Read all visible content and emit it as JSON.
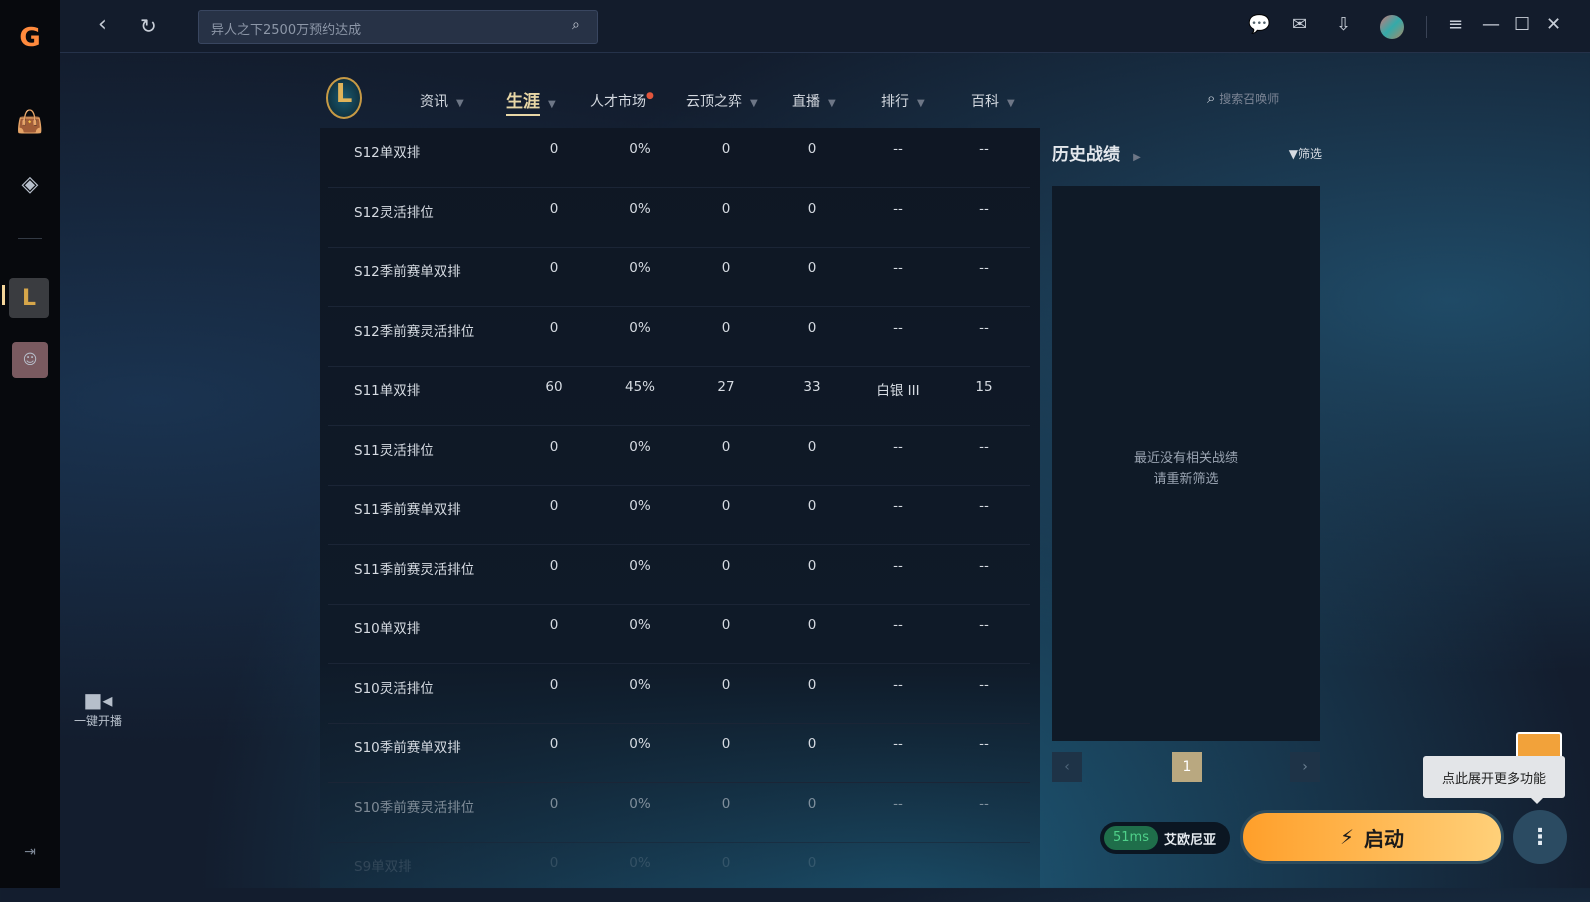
{
  "topbar": {
    "search_placeholder": "异人之下2500万预约达成"
  },
  "nav": {
    "items": [
      {
        "label": "资讯"
      },
      {
        "label": "生涯",
        "active": true
      },
      {
        "label": "人才市场"
      },
      {
        "label": "云顶之弈"
      },
      {
        "label": "直播"
      },
      {
        "label": "排行"
      },
      {
        "label": "百科"
      }
    ],
    "search_placeholder": "搜索召唤师"
  },
  "sidebar": {
    "live_label": "一键开播"
  },
  "table": {
    "rows": [
      [
        "S12单双排",
        "0",
        "0%",
        "0",
        "0",
        "--",
        "--"
      ],
      [
        "S12灵活排位",
        "0",
        "0%",
        "0",
        "0",
        "--",
        "--"
      ],
      [
        "S12季前赛单双排",
        "0",
        "0%",
        "0",
        "0",
        "--",
        "--"
      ],
      [
        "S12季前赛灵活排位",
        "0",
        "0%",
        "0",
        "0",
        "--",
        "--"
      ],
      [
        "S11单双排",
        "60",
        "45%",
        "27",
        "33",
        "白银 III",
        "15"
      ],
      [
        "S11灵活排位",
        "0",
        "0%",
        "0",
        "0",
        "--",
        "--"
      ],
      [
        "S11季前赛单双排",
        "0",
        "0%",
        "0",
        "0",
        "--",
        "--"
      ],
      [
        "S11季前赛灵活排位",
        "0",
        "0%",
        "0",
        "0",
        "--",
        "--"
      ],
      [
        "S10单双排",
        "0",
        "0%",
        "0",
        "0",
        "--",
        "--"
      ],
      [
        "S10灵活排位",
        "0",
        "0%",
        "0",
        "0",
        "--",
        "--"
      ],
      [
        "S10季前赛单双排",
        "0",
        "0%",
        "0",
        "0",
        "--",
        "--"
      ],
      [
        "S10季前赛灵活排位",
        "0",
        "0%",
        "0",
        "0",
        "--",
        "--"
      ],
      [
        "S9单双排",
        "0",
        "0%",
        "0",
        "0",
        "",
        ""
      ]
    ]
  },
  "history": {
    "title": "历史战绩",
    "filter_label": "筛选",
    "empty_line1": "最近没有相关战绩",
    "empty_line2": "请重新筛选",
    "current_page": "1"
  },
  "bottom": {
    "ping": "51ms",
    "server": "艾欧尼亚",
    "start_label": "启动",
    "tooltip": "点此展开更多功能"
  },
  "colors": {
    "accent": "#ffb347",
    "active_nav": "#e8d7a6",
    "ping_green": "#1f6e4a"
  }
}
